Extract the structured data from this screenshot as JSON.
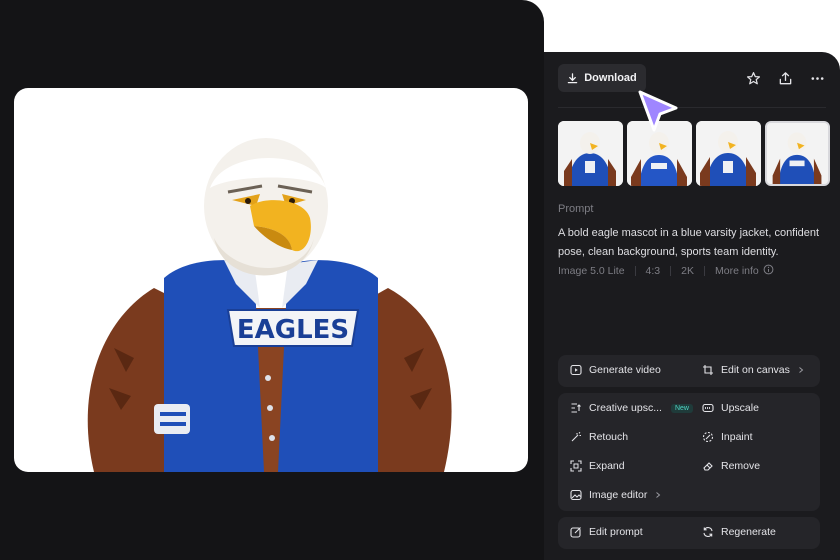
{
  "toolbar": {
    "download_label": "Download",
    "icons": [
      "download-icon",
      "star-icon",
      "share-icon",
      "more-icon"
    ]
  },
  "image": {
    "jacket_text": "EAGLES",
    "chest_letter": "E"
  },
  "thumbnails": [
    {
      "id": 1,
      "selected": false
    },
    {
      "id": 2,
      "selected": false
    },
    {
      "id": 3,
      "selected": false
    },
    {
      "id": 4,
      "selected": true
    }
  ],
  "prompt": {
    "label": "Prompt",
    "text": "A bold eagle mascot in a blue varsity jacket, confident pose, clean background, sports team identity."
  },
  "meta": {
    "model": "Image 5.0 Lite",
    "ratio": "4:3",
    "resolution": "2K",
    "more_info": "More info"
  },
  "actions": {
    "generate_video": "Generate video",
    "edit_on_canvas": "Edit on canvas",
    "creative_upscale": "Creative upsc...",
    "new_badge": "New",
    "upscale": "Upscale",
    "retouch": "Retouch",
    "inpaint": "Inpaint",
    "expand": "Expand",
    "remove": "Remove",
    "image_editor": "Image editor",
    "edit_prompt": "Edit prompt",
    "regenerate": "Regenerate"
  },
  "colors": {
    "background": "#141416",
    "panel": "#1b1b1e",
    "accent_cursor": "#a78bfa",
    "jacket_blue": "#1f4fb8"
  }
}
